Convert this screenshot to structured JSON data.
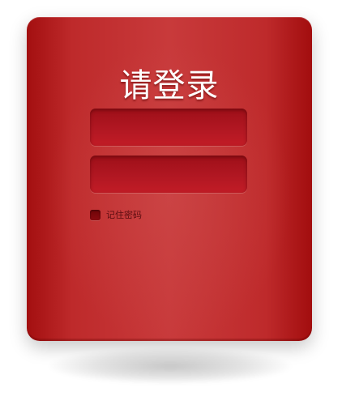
{
  "login": {
    "title": "请登录",
    "username": {
      "value": "",
      "placeholder": ""
    },
    "password": {
      "value": "",
      "placeholder": ""
    },
    "remember_label": "记住密码",
    "remember_checked": false
  },
  "colors": {
    "panel": "#c0302f",
    "panel_edge": "#a30f10",
    "field": "#b11722",
    "title": "#ffffff",
    "label": "#5a0c10"
  }
}
